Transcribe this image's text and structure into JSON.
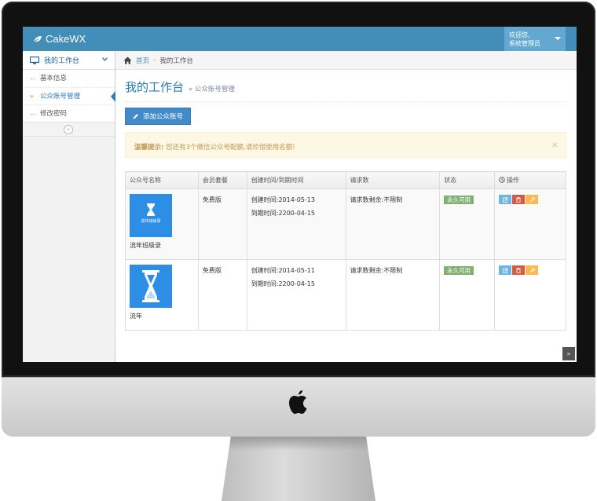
{
  "app": {
    "brand": "CakeWX"
  },
  "user_menu": {
    "greeting": "欢迎您,",
    "name": "系统管理员"
  },
  "sidebar": {
    "section_label": "我的工作台",
    "items": [
      {
        "label": "基本信息",
        "active": false
      },
      {
        "label": "公众账号管理",
        "active": true
      },
      {
        "label": "修改密码",
        "active": false
      }
    ]
  },
  "breadcrumb": {
    "home": "首页",
    "current": "我的工作台"
  },
  "page": {
    "title": "我的工作台",
    "subtitle": "» 公众账号管理"
  },
  "toolbar": {
    "add_label": "添加公众账号"
  },
  "alert": {
    "prefix": "温馨提示:",
    "message": "您还有3个微信公众号配额,请珍惜使用名额!",
    "close": "×"
  },
  "table": {
    "headers": [
      "公众号名称",
      "会员套餐",
      "创建时间/到期时间",
      "请求数",
      "状态",
      "操作"
    ],
    "rows": [
      {
        "name": "流年班级录",
        "thumb_text": "流年班级录",
        "plan": "免费版",
        "created": "创建时间:2014-05-13",
        "expires": "到期时间:2200-04-15",
        "requests": "请求数剩余:不限制",
        "status": "永久可用"
      },
      {
        "name": "流年",
        "thumb_text": "",
        "plan": "免费版",
        "created": "创建时间:2014-05-11",
        "expires": "到期时间:2200-04-15",
        "requests": "请求数剩余:不限制",
        "status": "永久可用"
      }
    ]
  },
  "colors": {
    "topbar": "#438eb9",
    "primary_button": "#428bca",
    "status_green": "#82af6f",
    "alert_bg": "#fcf8e3",
    "thumb_blue": "#2d8ee6"
  },
  "icons": [
    "leaf-icon",
    "monitor-icon",
    "chevron-down-icon",
    "home-icon",
    "pencil-icon",
    "clock-icon",
    "edit-icon",
    "trash-icon",
    "wrench-icon",
    "double-chevron-left-icon",
    "double-chevron-up-icon",
    "apple-logo"
  ]
}
